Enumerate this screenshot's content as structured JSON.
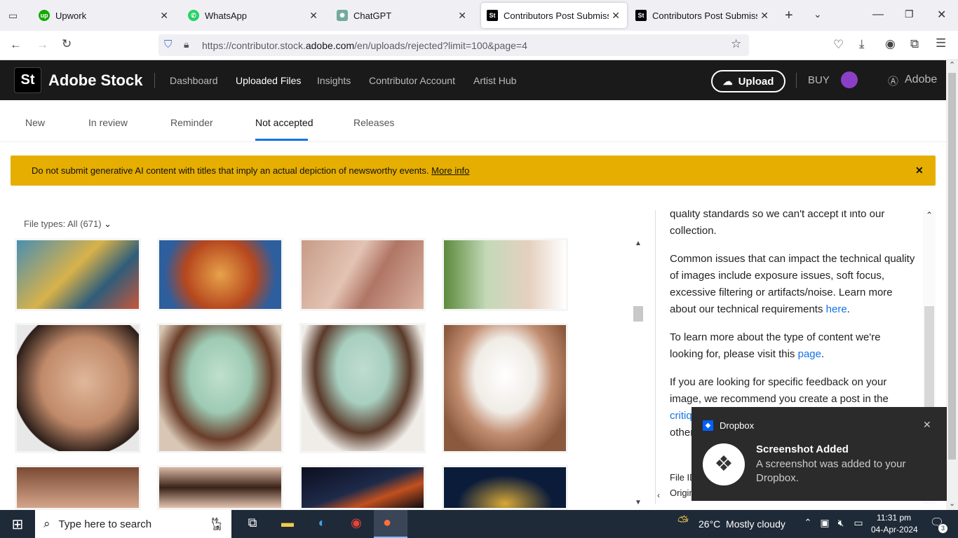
{
  "browser": {
    "tabs": [
      {
        "label": "Upwork",
        "favicon": "upwork-icon",
        "color": "#14a800"
      },
      {
        "label": "WhatsApp",
        "favicon": "whatsapp-icon",
        "color": "#25d366"
      },
      {
        "label": "ChatGPT",
        "favicon": "chatgpt-icon",
        "color": "#74aa9c"
      },
      {
        "label": "Contributors Post Submission",
        "favicon": "adobe-stock-icon",
        "color": "#000000"
      },
      {
        "label": "Contributors Post Submission",
        "favicon": "adobe-stock-icon",
        "color": "#000000"
      }
    ],
    "url_prefix": "https://contributor.stock.",
    "url_domain": "adobe.com",
    "url_suffix": "/en/uploads/rejected?limit=100&page=4"
  },
  "header": {
    "logo": "St",
    "brand": "Adobe Stock",
    "nav": [
      "Dashboard",
      "Uploaded Files",
      "Insights",
      "Contributor Account",
      "Artist Hub"
    ],
    "upload_label": "Upload",
    "buy_label": "BUY",
    "adobe_label": "Adobe"
  },
  "subtabs": [
    "New",
    "In review",
    "Reminder",
    "Not accepted",
    "Releases"
  ],
  "banner": {
    "text": "Do not submit generative AI content with titles that imply an actual depiction of newsworthy events.",
    "link": "More info",
    "bg": "#e6ae00"
  },
  "filetypes_label": "File types: All (671)",
  "panel": {
    "p0": "quality standards so we can't accept it into our collection.",
    "p1": "Common issues that can impact the technical quality of images include exposure issues, soft focus, excessive filtering or artifacts/noise. Learn more about our technical requirements",
    "p1_link": "here",
    "p2": "To learn more about the type of content we're looking for, please visit this",
    "p2_link": "page",
    "p3": "If you are looking for specific feedback on your image, we recommend you create a post in the",
    "p3_link": "critiq",
    "p4": "other",
    "p5": "File ID",
    "p6": "Origin"
  },
  "toast": {
    "app": "Dropbox",
    "title": "Screenshot Added",
    "body": "A screenshot was added to your Dropbox."
  },
  "taskbar": {
    "search_placeholder": "Type here to search",
    "weather": "26°C  Mostly cloudy",
    "time": "11:31 pm",
    "date": "04-Apr-2024",
    "notif_count": "3"
  }
}
